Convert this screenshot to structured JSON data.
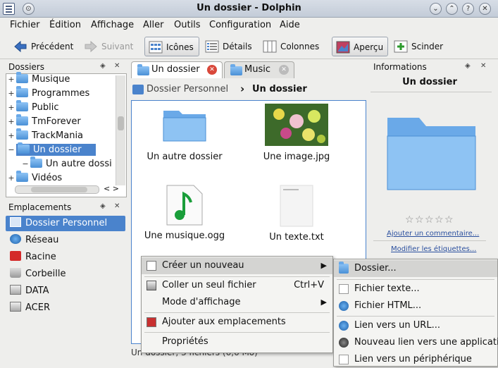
{
  "window": {
    "title": "Un dossier - Dolphin",
    "btn_help": "?",
    "btn_min": "⌄",
    "btn_max": "⌃",
    "btn_close": "✕",
    "btn_menu": "⊙"
  },
  "menu": [
    "Fichier",
    "Édition",
    "Affichage",
    "Aller",
    "Outils",
    "Configuration",
    "Aide"
  ],
  "toolbar": {
    "back": "Précédent",
    "forward": "Suivant",
    "icons": "Icônes",
    "details": "Détails",
    "columns": "Colonnes",
    "preview": "Aperçu",
    "split": "Scinder"
  },
  "folders_panel": {
    "title": "Dossiers",
    "items": [
      {
        "label": "Musique",
        "exp": "+"
      },
      {
        "label": "Programmes",
        "exp": "+"
      },
      {
        "label": "Public",
        "exp": "+"
      },
      {
        "label": "TmForever",
        "exp": "+"
      },
      {
        "label": "TrackMania",
        "exp": "+"
      },
      {
        "label": "Un dossier",
        "exp": "−"
      },
      {
        "label": "Un autre dossi",
        "exp": "−"
      },
      {
        "label": "Vidéos",
        "exp": "+"
      }
    ],
    "hscroll": "< >"
  },
  "places_panel": {
    "title": "Emplacements",
    "items": [
      "Dossier Personnel",
      "Réseau",
      "Racine",
      "Corbeille",
      "DATA",
      "ACER"
    ]
  },
  "tabs": [
    {
      "label": "Un dossier"
    },
    {
      "label": "Music"
    }
  ],
  "breadcrumb": {
    "home": "Dossier Personnel",
    "sep": "›",
    "current": "Un dossier"
  },
  "files": [
    {
      "name": "Un autre dossier",
      "type": "folder"
    },
    {
      "name": "Une image.jpg",
      "type": "image"
    },
    {
      "name": "Une musique.ogg",
      "type": "audio"
    },
    {
      "name": "Un texte.txt",
      "type": "text"
    }
  ],
  "statusbar": "Un dossier, 3 fichiers (6,6 Mo)",
  "info_panel": {
    "title": "Informations",
    "name": "Un dossier",
    "add_comment": "Ajouter un commentaire...",
    "edit_tags": "Modifier les étiquettes...",
    "rating": 0
  },
  "context_menu": {
    "items": [
      {
        "label": "Créer un nouveau",
        "submenu": true
      },
      {
        "label": "Coller un seul fichier",
        "shortcut": "Ctrl+V"
      },
      {
        "label": "Mode d'affichage",
        "submenu": true
      },
      {
        "label": "Ajouter aux emplacements"
      },
      {
        "label": "Propriétés"
      }
    ]
  },
  "submenu": {
    "items": [
      "Dossier...",
      "Fichier texte...",
      "Fichier HTML...",
      "Lien vers un URL...",
      "Nouveau lien vers une application",
      "Lien vers un périphérique"
    ]
  },
  "colors": {
    "selection": "#4a83cc",
    "titlebar": "#c3ccd8",
    "folder": "#6aa9e8"
  }
}
